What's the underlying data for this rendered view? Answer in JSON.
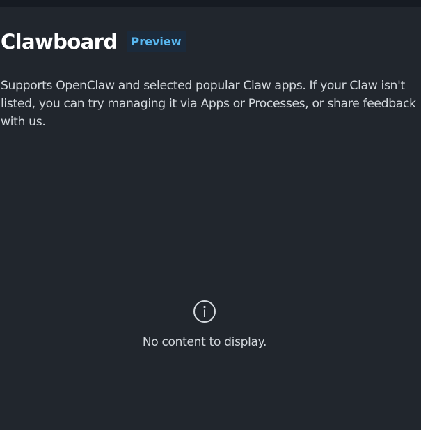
{
  "header": {
    "title": "Clawboard",
    "badge": "Preview"
  },
  "description": "Supports OpenClaw and selected popular Claw apps. If your Claw isn't listed, you can try managing it via Apps or Processes, or share feedback with us.",
  "empty_state": {
    "icon": "info-icon",
    "message": "No content to display."
  },
  "colors": {
    "background": "#21262d",
    "top_strip": "#161b22",
    "badge_background": "#1b2a3b",
    "badge_text": "#58b7f0"
  }
}
